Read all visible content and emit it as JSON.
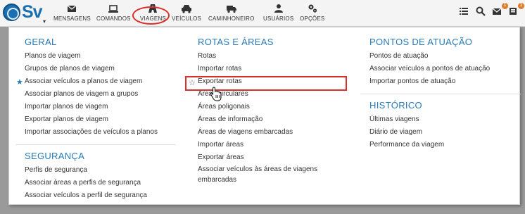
{
  "brand": {
    "text": "Sv",
    "caret": "▾"
  },
  "nav": [
    {
      "label": "MENSAGENS",
      "icon": "envelope-icon"
    },
    {
      "label": "COMANDOS",
      "icon": "laptop-icon"
    },
    {
      "label": "VIAGENS",
      "icon": "road-icon"
    },
    {
      "label": "VEÍCULOS",
      "icon": "car-icon"
    },
    {
      "label": "CAMINHONEIRO",
      "icon": "truck-icon"
    },
    {
      "label": "USUÁRIOS",
      "icon": "user-icon"
    },
    {
      "label": "OPÇÕES",
      "icon": "gears-icon"
    }
  ],
  "right_icons": [
    {
      "icon": "list-icon"
    },
    {
      "icon": "search-icon"
    },
    {
      "icon": "envelope-icon",
      "badge": "1"
    },
    {
      "icon": "alert-icon",
      "badge": "1"
    }
  ],
  "menu": {
    "col1": {
      "geral_title": "GERAL",
      "geral": [
        "Planos de viagem",
        "Grupos de planos de viagem",
        "Associar veículos a planos de viagem",
        "Associar planos de viagem a grupos",
        "Importar planos de viagem",
        "Exportar planos de viagem",
        "Importar associações de veículos a planos"
      ],
      "seg_title": "SEGURANÇA",
      "seg": [
        "Perfis de segurança",
        "Associar áreas a perfis de segurança",
        "Associar veículos a perfil de segurança"
      ]
    },
    "col2": {
      "title": "ROTAS E ÁREAS",
      "items": [
        "Rotas",
        "Importar rotas",
        "Exportar rotas",
        "Áreas circulares",
        "Áreas poligonais",
        "Áreas de informação",
        "Áreas de viagens embarcadas",
        "Importar áreas",
        "Exportar áreas",
        "Associar veículos às áreas de viagens embarcadas"
      ]
    },
    "col3": {
      "pontos_title": "PONTOS DE ATUAÇÃO",
      "pontos": [
        "Pontos de atuação",
        "Associar veículos a pontos de atuação",
        "Importar pontos de atuação"
      ],
      "hist_title": "HISTÓRICO",
      "hist": [
        "Últimas viagens",
        "Diário de viagem",
        "Performance da viagem"
      ]
    }
  },
  "colors": {
    "accent": "#2a7ab6",
    "highlight": "#d9302c",
    "badge": "#e07b26"
  }
}
